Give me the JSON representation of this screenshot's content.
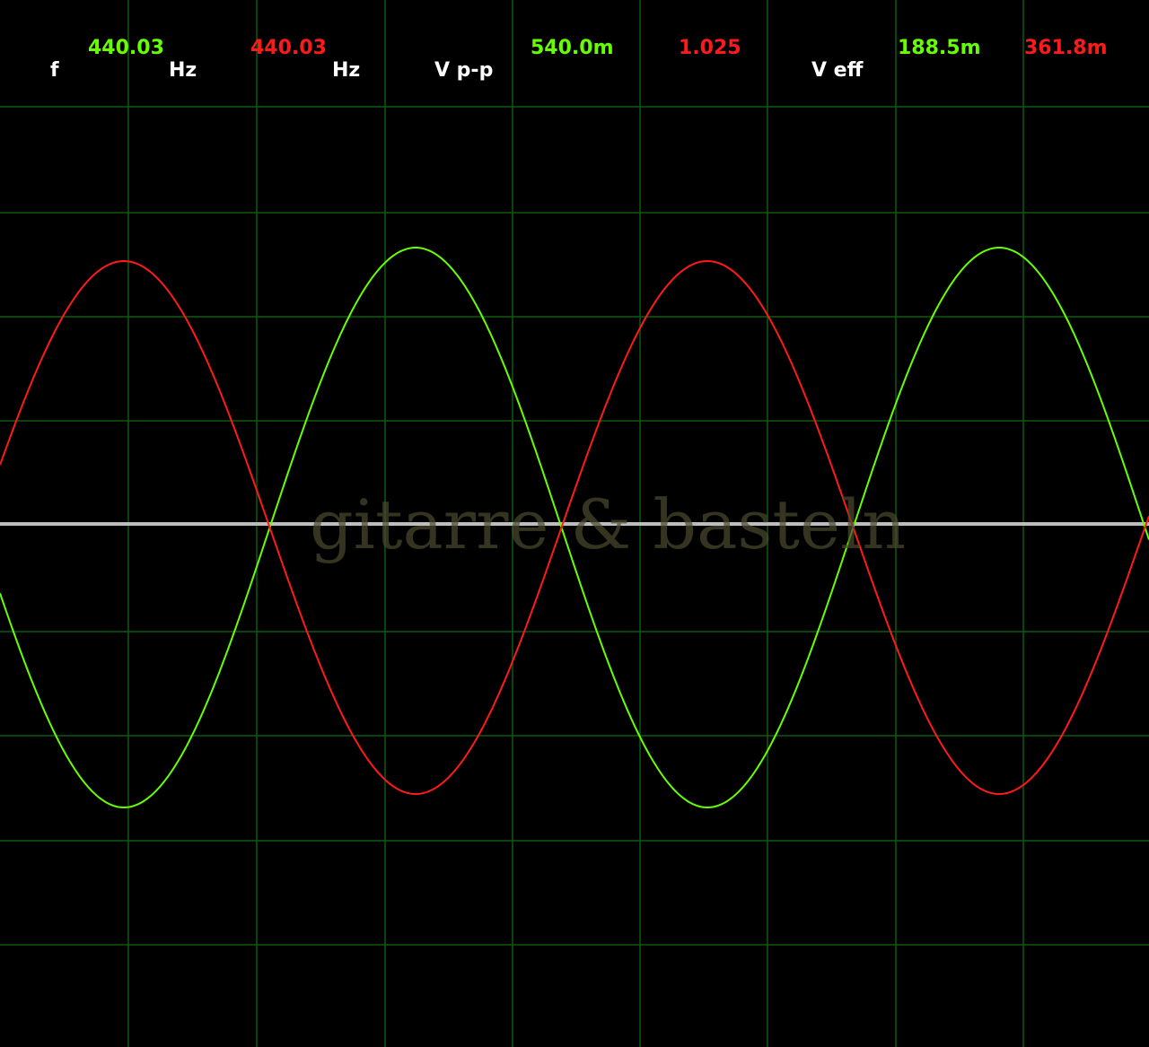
{
  "readouts": {
    "frequency": {
      "label": "f",
      "unit_ch1": "Hz",
      "unit_ch2": "Hz",
      "ch1_value": "440.03",
      "ch2_value": "440.03"
    },
    "peak_to_peak": {
      "label": "V p-p",
      "ch1_value": "540.0m",
      "ch2_value": "1.025"
    },
    "rms": {
      "label": "V eff",
      "ch1_value": "188.5m",
      "ch2_value": "361.8m"
    }
  },
  "watermark": "gitarre & basteln",
  "colors": {
    "background": "#000000",
    "grid": "#0e5a0e",
    "ch1_trace": "#66ff00",
    "ch2_trace": "#ff1a1a",
    "center_line": "#bdbdbd"
  },
  "icons": {
    "grid": "oscilloscope-grid"
  }
}
